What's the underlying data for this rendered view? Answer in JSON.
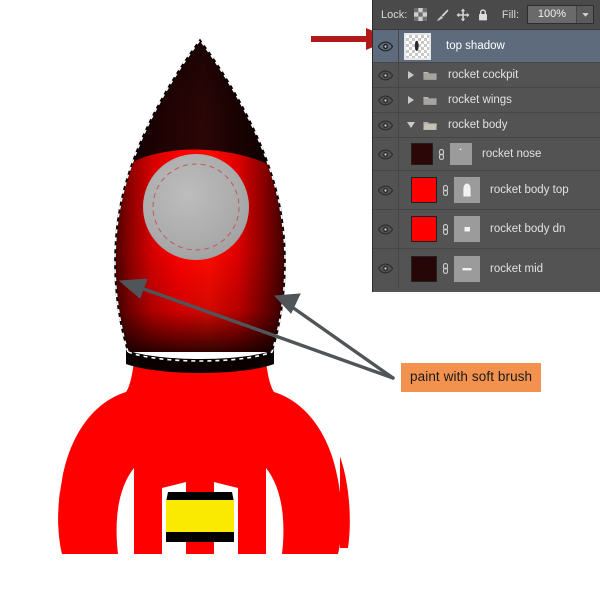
{
  "app": {
    "title": "Photoshop Layers Panel with Rocket Artwork"
  },
  "panel": {
    "toolbar": {
      "lock_label": "Lock:",
      "lock_icons": [
        {
          "name": "lock-transparent-pixels-icon",
          "glyph": "checker"
        },
        {
          "name": "lock-image-pixels-icon",
          "glyph": "brush"
        },
        {
          "name": "lock-position-icon",
          "glyph": "move"
        },
        {
          "name": "lock-all-icon",
          "glyph": "padlock"
        }
      ],
      "fill_label": "Fill:",
      "fill_value": "100%",
      "fill_dropdown_icon": "chevron-down-icon"
    },
    "layers": [
      {
        "name": "top shadow",
        "selected": true,
        "visible": true,
        "kind": "pixel",
        "thumb_type": "transparent",
        "indent": 0,
        "has_group_arrow": false,
        "expanded": false,
        "linked": false,
        "color": "",
        "mask": ""
      },
      {
        "name": "rocket cockpit",
        "selected": false,
        "visible": true,
        "kind": "group",
        "thumb_type": "folder",
        "indent": 0,
        "has_group_arrow": true,
        "expanded": false,
        "linked": false,
        "color": "",
        "mask": ""
      },
      {
        "name": "rocket wings",
        "selected": false,
        "visible": true,
        "kind": "group",
        "thumb_type": "folder",
        "indent": 0,
        "has_group_arrow": true,
        "expanded": false,
        "linked": false,
        "color": "",
        "mask": ""
      },
      {
        "name": "rocket body",
        "selected": false,
        "visible": true,
        "kind": "group",
        "thumb_type": "folder",
        "indent": 0,
        "has_group_arrow": true,
        "expanded": true,
        "linked": false,
        "color": "",
        "mask": ""
      },
      {
        "name": "rocket nose",
        "selected": false,
        "visible": true,
        "kind": "shape",
        "thumb_type": "color",
        "indent": 1,
        "has_group_arrow": false,
        "expanded": false,
        "linked": true,
        "color": "#2b0707",
        "mask": "nose"
      },
      {
        "name": "rocket body top",
        "selected": false,
        "visible": true,
        "kind": "shape",
        "thumb_type": "color",
        "indent": 1,
        "has_group_arrow": false,
        "expanded": false,
        "linked": true,
        "color": "#fe0000",
        "mask": "dome"
      },
      {
        "name": "rocket body dn",
        "selected": false,
        "visible": true,
        "kind": "shape",
        "thumb_type": "color",
        "indent": 1,
        "has_group_arrow": false,
        "expanded": false,
        "linked": true,
        "color": "#fe0000",
        "mask": "square"
      },
      {
        "name": "rocket mid",
        "selected": false,
        "visible": true,
        "kind": "shape",
        "thumb_type": "color",
        "indent": 1,
        "has_group_arrow": false,
        "expanded": false,
        "linked": true,
        "color": "#260606",
        "mask": "bar"
      }
    ]
  },
  "annotations": {
    "callout_label": "paint with soft brush",
    "callout_color": "#F2924E",
    "pointer_arrow_color": "#505559",
    "highlight_arrow_color": "#B01B19"
  },
  "artwork": {
    "name": "rocket-illustration",
    "colors": {
      "body_red": "#FE0000",
      "nose_dark": "#1B0303",
      "window_gray": "#A8A8A8",
      "nozzle_yellow": "#FAE900",
      "band_black": "#000000",
      "background": "#FFFFFF"
    },
    "selection_marquee": "marching-ants around rocket upper body"
  }
}
